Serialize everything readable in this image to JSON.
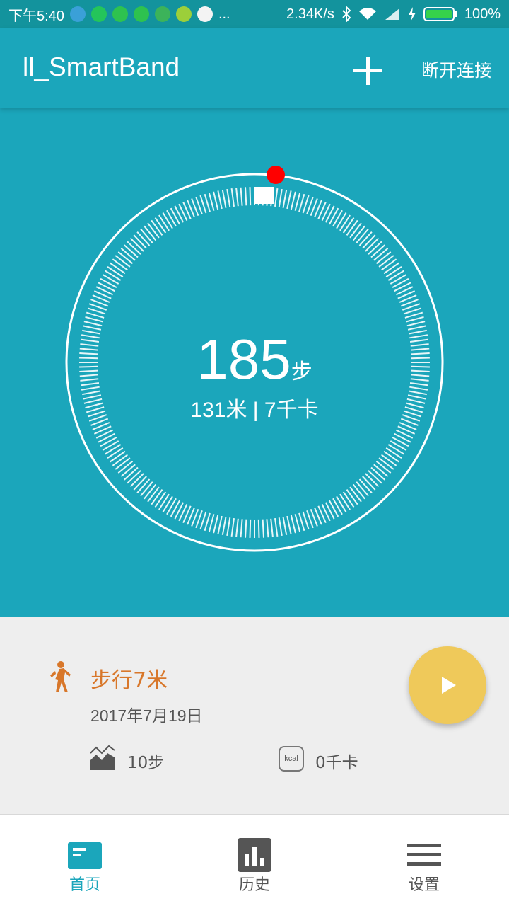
{
  "status_bar": {
    "time": "下午5:40",
    "more": "...",
    "net_speed": "2.34K/s",
    "battery": "100%",
    "icons": [
      "usb-icon",
      "app-icon",
      "wechat-icon",
      "wechat-icon",
      "tt-icon",
      "app-icon",
      "app-icon",
      "bluetooth-icon",
      "wifi-icon",
      "signal-icon",
      "charging-icon",
      "battery-icon"
    ]
  },
  "app_bar": {
    "title": "ll_SmartBand",
    "add_icon": "plus-icon",
    "disconnect_label": "断开连接"
  },
  "summary": {
    "steps": "185",
    "steps_unit": "步",
    "distance_calories": "131米 | 7千卡",
    "progress_fraction": 0.02
  },
  "activity": {
    "title": "步行7米",
    "date": "2017年7月19日",
    "steps": "10步",
    "kcal_icon_label": "kcal",
    "calories": "0千卡",
    "play_icon": "play-icon"
  },
  "bottom_nav": {
    "items": [
      {
        "label": "首页",
        "icon": "home-icon",
        "active": true
      },
      {
        "label": "历史",
        "icon": "chart-icon",
        "active": false
      },
      {
        "label": "设置",
        "icon": "menu-icon",
        "active": false
      }
    ]
  },
  "colors": {
    "primary": "#1ba6bb",
    "accent_orange": "#d8772a",
    "fab_yellow": "#efc95a",
    "indicator_red": "#ff0000"
  }
}
